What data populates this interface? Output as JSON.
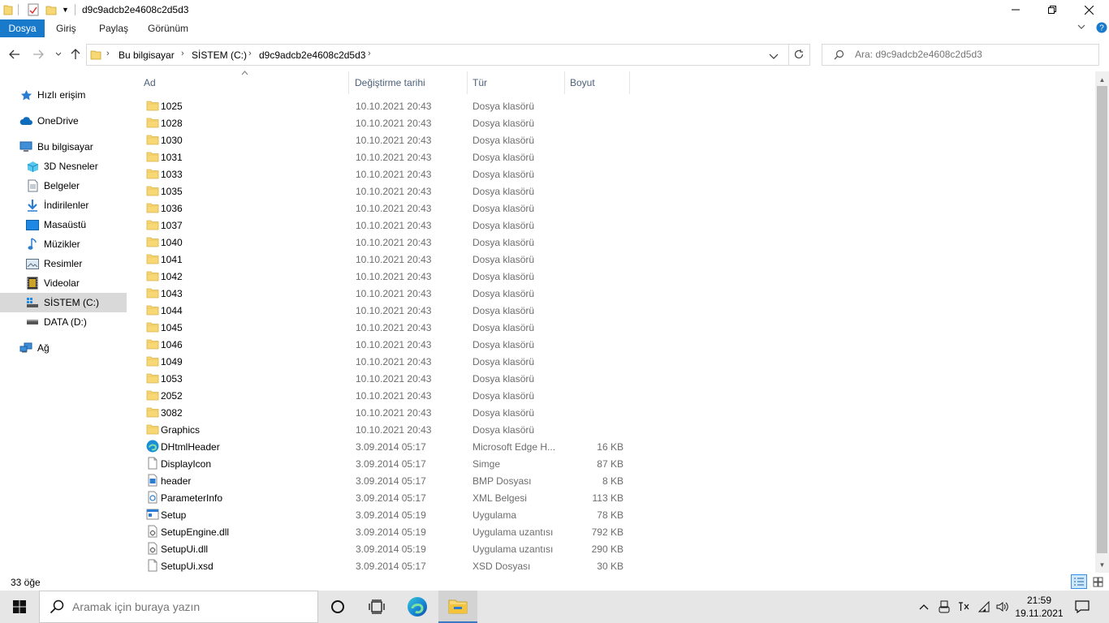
{
  "window": {
    "title": "d9c9adcb2e4608c2d5d3",
    "minimize_icon": "minimize-icon",
    "maximize_icon": "restore-icon",
    "close_icon": "close-icon"
  },
  "ribbon": {
    "tabs": [
      "Dosya",
      "Giriş",
      "Paylaş",
      "Görünüm"
    ],
    "expand_icon": "chevron-down-icon",
    "help_icon": "help-icon"
  },
  "address": {
    "segments": [
      "Bu bilgisayar",
      "SİSTEM (C:)",
      "d9c9adcb2e4608c2d5d3"
    ],
    "search_placeholder": "Ara: d9c9adcb2e4608c2d5d3"
  },
  "nav": {
    "items": [
      {
        "label": "Hızlı erişim",
        "icon": "star-icon"
      },
      {
        "label": "OneDrive",
        "icon": "cloud-icon"
      },
      {
        "label": "Bu bilgisayar",
        "icon": "computer-icon"
      },
      {
        "label": "3D Nesneler",
        "icon": "cube-icon"
      },
      {
        "label": "Belgeler",
        "icon": "document-icon"
      },
      {
        "label": "İndirilenler",
        "icon": "download-icon"
      },
      {
        "label": "Masaüstü",
        "icon": "desktop-icon"
      },
      {
        "label": "Müzikler",
        "icon": "music-icon"
      },
      {
        "label": "Resimler",
        "icon": "pictures-icon"
      },
      {
        "label": "Videolar",
        "icon": "video-icon"
      },
      {
        "label": "SİSTEM (C:)",
        "icon": "drive-icon"
      },
      {
        "label": "DATA (D:)",
        "icon": "drive-icon"
      },
      {
        "label": "Ağ",
        "icon": "network-icon"
      }
    ]
  },
  "columns": [
    "Ad",
    "Değiştirme tarihi",
    "Tür",
    "Boyut"
  ],
  "files": [
    {
      "name": "1025",
      "date": "10.10.2021 20:43",
      "type": "Dosya klasörü",
      "size": "",
      "icon": "folder"
    },
    {
      "name": "1028",
      "date": "10.10.2021 20:43",
      "type": "Dosya klasörü",
      "size": "",
      "icon": "folder"
    },
    {
      "name": "1030",
      "date": "10.10.2021 20:43",
      "type": "Dosya klasörü",
      "size": "",
      "icon": "folder"
    },
    {
      "name": "1031",
      "date": "10.10.2021 20:43",
      "type": "Dosya klasörü",
      "size": "",
      "icon": "folder"
    },
    {
      "name": "1033",
      "date": "10.10.2021 20:43",
      "type": "Dosya klasörü",
      "size": "",
      "icon": "folder"
    },
    {
      "name": "1035",
      "date": "10.10.2021 20:43",
      "type": "Dosya klasörü",
      "size": "",
      "icon": "folder"
    },
    {
      "name": "1036",
      "date": "10.10.2021 20:43",
      "type": "Dosya klasörü",
      "size": "",
      "icon": "folder"
    },
    {
      "name": "1037",
      "date": "10.10.2021 20:43",
      "type": "Dosya klasörü",
      "size": "",
      "icon": "folder"
    },
    {
      "name": "1040",
      "date": "10.10.2021 20:43",
      "type": "Dosya klasörü",
      "size": "",
      "icon": "folder"
    },
    {
      "name": "1041",
      "date": "10.10.2021 20:43",
      "type": "Dosya klasörü",
      "size": "",
      "icon": "folder"
    },
    {
      "name": "1042",
      "date": "10.10.2021 20:43",
      "type": "Dosya klasörü",
      "size": "",
      "icon": "folder"
    },
    {
      "name": "1043",
      "date": "10.10.2021 20:43",
      "type": "Dosya klasörü",
      "size": "",
      "icon": "folder"
    },
    {
      "name": "1044",
      "date": "10.10.2021 20:43",
      "type": "Dosya klasörü",
      "size": "",
      "icon": "folder"
    },
    {
      "name": "1045",
      "date": "10.10.2021 20:43",
      "type": "Dosya klasörü",
      "size": "",
      "icon": "folder"
    },
    {
      "name": "1046",
      "date": "10.10.2021 20:43",
      "type": "Dosya klasörü",
      "size": "",
      "icon": "folder"
    },
    {
      "name": "1049",
      "date": "10.10.2021 20:43",
      "type": "Dosya klasörü",
      "size": "",
      "icon": "folder"
    },
    {
      "name": "1053",
      "date": "10.10.2021 20:43",
      "type": "Dosya klasörü",
      "size": "",
      "icon": "folder"
    },
    {
      "name": "2052",
      "date": "10.10.2021 20:43",
      "type": "Dosya klasörü",
      "size": "",
      "icon": "folder"
    },
    {
      "name": "3082",
      "date": "10.10.2021 20:43",
      "type": "Dosya klasörü",
      "size": "",
      "icon": "folder"
    },
    {
      "name": "Graphics",
      "date": "10.10.2021 20:43",
      "type": "Dosya klasörü",
      "size": "",
      "icon": "folder"
    },
    {
      "name": "DHtmlHeader",
      "date": "3.09.2014 05:17",
      "type": "Microsoft Edge H...",
      "size": "16 KB",
      "icon": "edge"
    },
    {
      "name": "DisplayIcon",
      "date": "3.09.2014 05:17",
      "type": "Simge",
      "size": "87 KB",
      "icon": "file"
    },
    {
      "name": "header",
      "date": "3.09.2014 05:17",
      "type": "BMP Dosyası",
      "size": "8 KB",
      "icon": "image"
    },
    {
      "name": "ParameterInfo",
      "date": "3.09.2014 05:17",
      "type": "XML Belgesi",
      "size": "113 KB",
      "icon": "xml"
    },
    {
      "name": "Setup",
      "date": "3.09.2014 05:19",
      "type": "Uygulama",
      "size": "78 KB",
      "icon": "exe"
    },
    {
      "name": "SetupEngine.dll",
      "date": "3.09.2014 05:19",
      "type": "Uygulama uzantısı",
      "size": "792 KB",
      "icon": "dll"
    },
    {
      "name": "SetupUi.dll",
      "date": "3.09.2014 05:19",
      "type": "Uygulama uzantısı",
      "size": "290 KB",
      "icon": "dll"
    },
    {
      "name": "SetupUi.xsd",
      "date": "3.09.2014 05:17",
      "type": "XSD Dosyası",
      "size": "30 KB",
      "icon": "file"
    }
  ],
  "status": {
    "count": "33 öğe"
  },
  "taskbar": {
    "search_placeholder": "Aramak için buraya yazın",
    "time": "21:59",
    "date": "19.11.2021"
  },
  "colors": {
    "file_tab": "#1979ca",
    "folder_yellow": "#f8d775",
    "selected_nav": "#d9d9d9"
  }
}
